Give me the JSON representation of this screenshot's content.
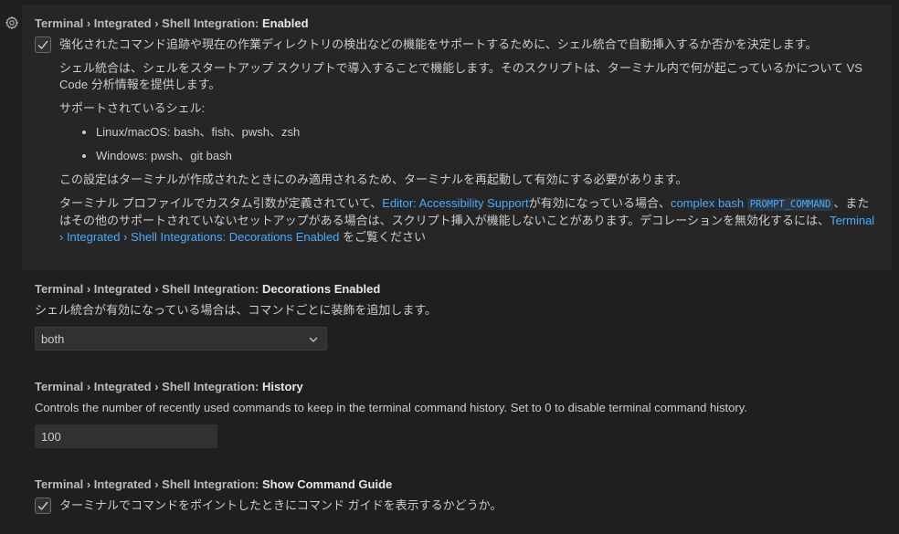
{
  "settings": [
    {
      "category": "Terminal › Integrated › Shell Integration: ",
      "name": "Enabled",
      "checkbox_label": "強化されたコマンド追跡や現在の作業ディレクトリの検出などの機能をサポートするために、シェル統合で自動挿入するか否かを決定します。",
      "checked": true,
      "para1": "シェル統合は、シェルをスタートアップ スクリプトで導入することで機能します。そのスクリプトは、ターミナル内で何が起こっているかについて VS Code 分析情報を提供します。",
      "para2": "サポートされているシェル:",
      "shells": [
        "Linux/macOS: bash、fish、pwsh、zsh",
        "Windows: pwsh、git bash"
      ],
      "para3": "この設定はターミナルが作成されたときにのみ適用されるため、ターミナルを再起動して有効にする必要があります。",
      "para4_a": "ターミナル プロファイルでカスタム引数が定義されていて、",
      "para4_link1": "Editor: Accessibility Support",
      "para4_b": "が有効になっている場合、",
      "para4_link2": "complex bash",
      "para4_code": "PROMPT_COMMAND",
      "para4_c": "、またはその他のサポートされていないセットアップがある場合は、スクリプト挿入が機能しないことがあります。デコレーションを無効化するには、",
      "para4_link3": "Terminal › Integrated › Shell Integrations: Decorations Enabled",
      "para4_d": " をご覧ください"
    },
    {
      "category": "Terminal › Integrated › Shell Integration: ",
      "name": "Decorations Enabled",
      "description": "シェル統合が有効になっている場合は、コマンドごとに装飾を追加します。",
      "value": "both"
    },
    {
      "category": "Terminal › Integrated › Shell Integration: ",
      "name": "History",
      "description": "Controls the number of recently used commands to keep in the terminal command history. Set to 0 to disable terminal command history.",
      "value": "100"
    },
    {
      "category": "Terminal › Integrated › Shell Integration: ",
      "name": "Show Command Guide",
      "checkbox_label": "ターミナルでコマンドをポイントしたときにコマンド ガイドを表示するかどうか。",
      "checked": true
    }
  ],
  "icons": {
    "gear": "gear-icon",
    "check": "check-icon",
    "chevron": "chevron-down-icon"
  },
  "colors": {
    "background": "#1f1f1f",
    "focused_row": "#262626",
    "link": "#4daafc",
    "text": "#cccccc"
  }
}
